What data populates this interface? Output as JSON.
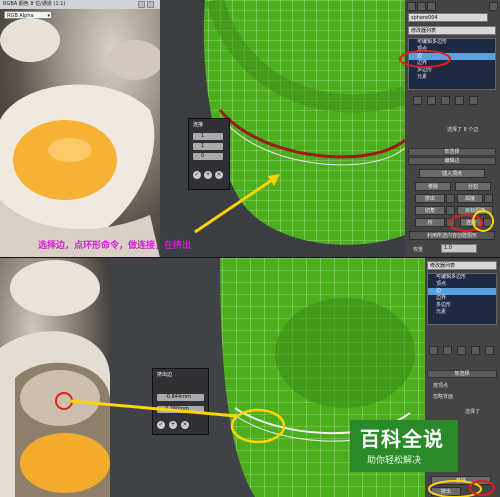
{
  "top_render": {
    "title": "RGBA 颜色 8 位/通道 (1:1)",
    "channel": "RGB Alpha"
  },
  "top_caddy": {
    "label": "连接",
    "fields": [
      "1",
      "1",
      "0"
    ]
  },
  "top_panel": {
    "object_name": "sphere004",
    "modifier_list_label": "修改器列表",
    "stack": [
      "可编辑多边形",
      "顶点",
      "边",
      "边界",
      "多边形",
      "元素"
    ],
    "stack_selected_index": 2,
    "selection_info": "选择了 8 个边",
    "soft_selection": "软选择",
    "edit_edges": "编辑边",
    "insert_vertex": "插入顶点",
    "remove": "移除",
    "split": "分割",
    "extrude": "挤出",
    "weld": "焊接",
    "chamfer": "切角",
    "target_weld": "目标焊接",
    "bridge": "桥",
    "connect": "连接",
    "create_shape": "利用所选内容创建图形",
    "weight_label": "权重",
    "weight_value": "1.0"
  },
  "annotation": {
    "text": "选择边，点环形命令，做连接，在挤出",
    "color": "#d81bd8",
    "circle_color": "#ffd400",
    "arrow_color": "#ffd400"
  },
  "bottom_caddy": {
    "label": "挤出边",
    "height": "-0.644mm",
    "width": "0.260mm"
  },
  "bottom_panel": {
    "modifier_list_label": "修改器列表",
    "stack": [
      "可编辑多边形",
      "顶点",
      "边",
      "边界",
      "多边形",
      "元素"
    ],
    "stack_selected_index": 2,
    "soft_selection": "软选择",
    "by_vertex": "按顶点",
    "ignore_backfacing": "忽略背面",
    "selection_info": "选择了",
    "remove": "移除",
    "extrude": "挤出"
  },
  "watermark": {
    "title": "百科全说",
    "subtitle": "助你轻松解决"
  }
}
